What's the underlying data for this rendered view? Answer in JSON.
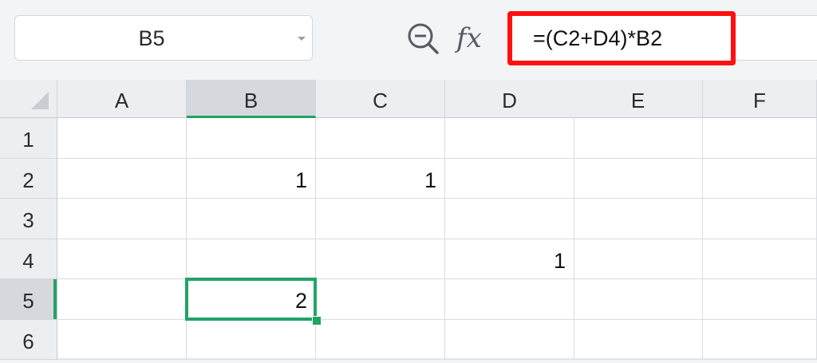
{
  "name_box": {
    "value": "B5"
  },
  "formula_bar": {
    "formula": "=(C2+D4)*B2",
    "fx_label": "fx"
  },
  "grid": {
    "columns": [
      "A",
      "B",
      "C",
      "D",
      "E",
      "F"
    ],
    "rows": [
      "1",
      "2",
      "3",
      "4",
      "5",
      "6"
    ],
    "active_column": "B",
    "active_row": "5",
    "cells": {
      "B2": "1",
      "C2": "1",
      "D4": "1",
      "B5": "2"
    }
  },
  "colors": {
    "selection": "#21a366",
    "formula_highlight": "#ff1010"
  }
}
